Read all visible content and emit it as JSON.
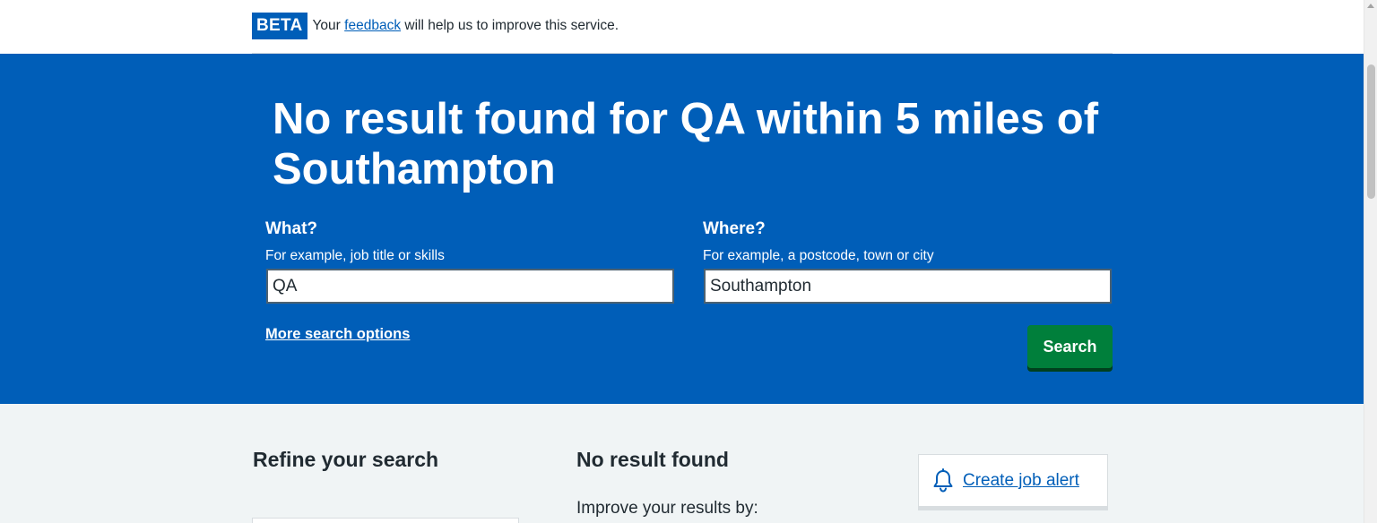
{
  "beta_banner": {
    "tag": "BETA",
    "text_before": "Your",
    "link_text": "feedback",
    "text_after": "will help us to improve this service."
  },
  "hero": {
    "title": "No result found for QA within 5 miles of Southampton",
    "what": {
      "label": "What?",
      "hint": "For example, job title or skills",
      "value": "QA"
    },
    "where": {
      "label": "Where?",
      "hint": "For example, a postcode, town or city",
      "value": "Southampton"
    },
    "more_options": "More search options",
    "search_button": "Search"
  },
  "results": {
    "refine_heading": "Refine your search",
    "no_result_heading": "No result found",
    "improve_text": "Improve your results by:",
    "job_alert_link": "Create job alert",
    "job_alert_icon": "bell-icon"
  },
  "colors": {
    "brand_blue": "#005eb8",
    "button_green": "#007f3b",
    "background_grey": "#f0f4f5"
  }
}
